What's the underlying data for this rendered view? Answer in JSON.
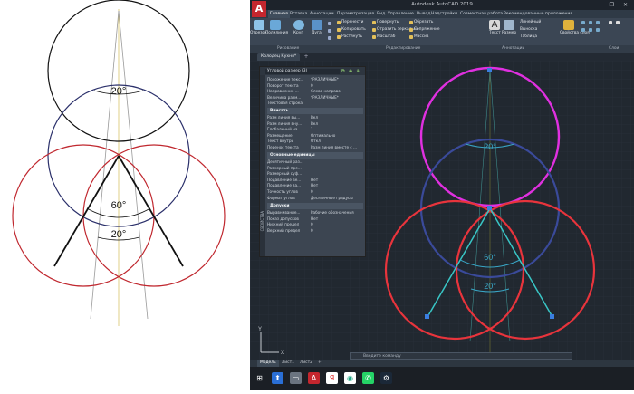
{
  "left_sketch": {
    "angle_top": "20°",
    "angle_middle": "60°",
    "angle_bottom": "20°"
  },
  "window": {
    "title": "Autodesk AutoCAD 2019",
    "logo_letter": "A",
    "controls": "— ❐ ✕"
  },
  "ribbon": {
    "tabs": [
      "Главная",
      "Вставка",
      "Аннотации",
      "Параметризация",
      "Вид",
      "Управление",
      "Вывод",
      "Надстройки",
      "Совместная работа",
      "Рекомендованные приложения"
    ],
    "draw_tools": [
      "Отрезок",
      "Полилиния",
      "Круг",
      "Дуга"
    ],
    "modify_tools": [
      "Перенести",
      "Повернуть",
      "Обрезать",
      "Копировать",
      "Отразить зеркально",
      "Сопряжение",
      "Растянуть",
      "Масштаб",
      "Массив"
    ],
    "annotation_tools": [
      "Текст",
      "Размер",
      "Линейный",
      "Выноска",
      "Таблица"
    ],
    "layer_tools": [
      "Свойства слоя"
    ],
    "panels": [
      "Рисование",
      "Редактирование",
      "Аннотации",
      "Слои"
    ]
  },
  "doc_tab": {
    "label": "Колодец Кухня*",
    "add": "+"
  },
  "properties": {
    "selector": "Угловой размер (3)",
    "side_label": "СВОЙСТВА",
    "rows_a": [
      {
        "k": "Положение текс...",
        "v": "*РАЗЛИЧНЫЕ*"
      },
      {
        "k": "Поворот текста",
        "v": "0"
      },
      {
        "k": "Направление ...",
        "v": "Слева направо"
      },
      {
        "k": "Величина разм...",
        "v": "*РАЗЛИЧНЫЕ*"
      },
      {
        "k": "Текстовая строка",
        "v": ""
      }
    ],
    "section_fit": "Вписать",
    "rows_b": [
      {
        "k": "Разм линия вы...",
        "v": "Вкл"
      },
      {
        "k": "Разм линия вну...",
        "v": "Вкл"
      },
      {
        "k": "Глобальный на...",
        "v": "1"
      },
      {
        "k": "Размещение",
        "v": "Оптимально"
      },
      {
        "k": "Текст внутри",
        "v": "Откл"
      },
      {
        "k": "Перенос текста",
        "v": "Разм линия вместе с ..."
      }
    ],
    "section_units": "Основные единицы",
    "rows_c": [
      {
        "k": "Десятичный раз...",
        "v": ""
      },
      {
        "k": "Размерный пре...",
        "v": ""
      },
      {
        "k": "Размерный суф...",
        "v": ""
      },
      {
        "k": "Подавление ве...",
        "v": "Нет"
      },
      {
        "k": "Подавление за...",
        "v": "Нет"
      },
      {
        "k": "Точность углов",
        "v": "0"
      },
      {
        "k": "Формат углов",
        "v": "Десятичные градусы"
      }
    ],
    "section_tol": "Допуски",
    "rows_d": [
      {
        "k": "Выравнивание...",
        "v": "Рабочие обозначения"
      },
      {
        "k": "Показ допусков",
        "v": "Нет"
      },
      {
        "k": "Нижний предел",
        "v": "0"
      },
      {
        "k": "Верхний предел",
        "v": "0"
      }
    ]
  },
  "drawing": {
    "angle_top": "20°",
    "angle_middle": "60°",
    "angle_bottom": "20°",
    "ucs_y": "Y",
    "ucs_x": "X"
  },
  "command_line": {
    "placeholder": "Введите команду"
  },
  "status_tabs": [
    "Модель",
    "Лист1",
    "Лист2",
    "+"
  ],
  "taskbar_icons": [
    "windows-start",
    "upload",
    "autocad",
    "yandex",
    "chrome",
    "whatsapp",
    "steam"
  ]
}
